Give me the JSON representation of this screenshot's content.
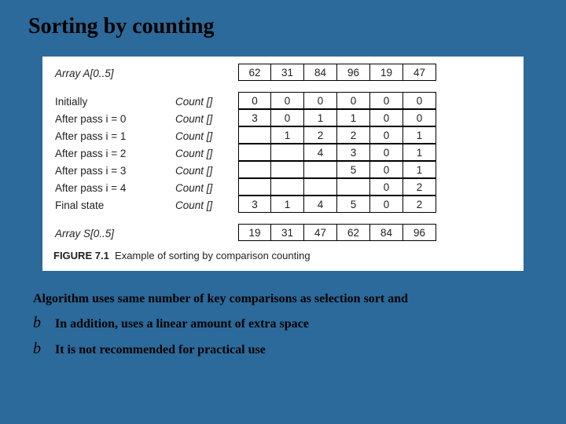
{
  "title": "Sorting by counting",
  "figure": {
    "array_top_label": "Array A[0..5]",
    "array_top_values": [
      "62",
      "31",
      "84",
      "96",
      "19",
      "47"
    ],
    "rows": [
      {
        "label": "Initially",
        "mid": "Count []",
        "cells": [
          "0",
          "0",
          "0",
          "0",
          "0",
          "0"
        ]
      },
      {
        "label_pre": "After pass  i  = 0",
        "mid": "Count []",
        "cells": [
          "3",
          "0",
          "1",
          "1",
          "0",
          "0"
        ]
      },
      {
        "label_pre": "After pass  i  = 1",
        "mid": "Count []",
        "cells": [
          "",
          "1",
          "2",
          "2",
          "0",
          "1"
        ]
      },
      {
        "label_pre": "After pass  i  = 2",
        "mid": "Count []",
        "cells": [
          "",
          "",
          "4",
          "3",
          "0",
          "1"
        ]
      },
      {
        "label_pre": "After pass  i  = 3",
        "mid": "Count []",
        "cells": [
          "",
          "",
          "",
          "5",
          "0",
          "1"
        ]
      },
      {
        "label_pre": "After pass  i  = 4",
        "mid": "Count []",
        "cells": [
          "",
          "",
          "",
          "",
          "0",
          "2"
        ]
      },
      {
        "label": "Final state",
        "mid": "Count []",
        "cells": [
          "3",
          "1",
          "4",
          "5",
          "0",
          "2"
        ]
      }
    ],
    "array_bottom_label": "Array S[0..5]",
    "array_bottom_values": [
      "19",
      "31",
      "47",
      "62",
      "84",
      "96"
    ],
    "caption_label": "FIGURE 7.1",
    "caption_text": "Example of sorting by comparison counting"
  },
  "notes": {
    "line1": "Algorithm uses same number of key comparisons as selection sort and",
    "bullet_glyph": "b",
    "bullets": [
      "In addition, uses a linear amount of extra space",
      "It is not recommended for practical use"
    ]
  }
}
